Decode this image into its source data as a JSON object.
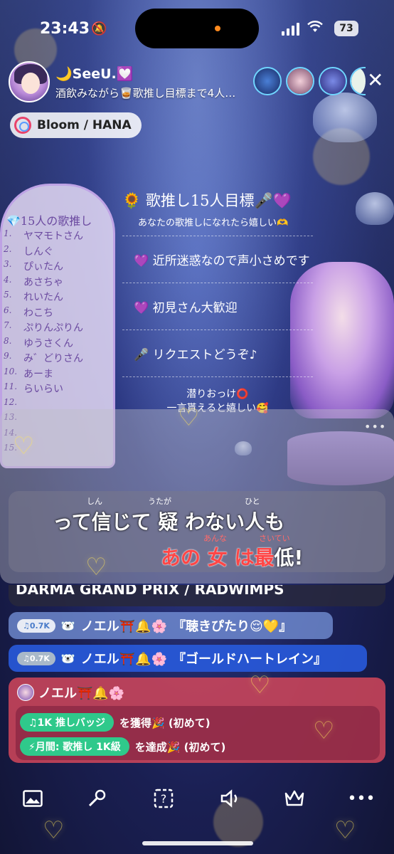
{
  "status": {
    "time": "23:43",
    "battery": "73"
  },
  "header": {
    "streamer_name": "🌙SeeU.💟",
    "subtitle": "酒飲みながら🥃歌推し目標まで4人…",
    "chip_label": "Bloom / HANA"
  },
  "left_panel": {
    "title": "💎15人の歌推し",
    "items": [
      {
        "num": "1.",
        "name": "ヤマモトさん"
      },
      {
        "num": "2.",
        "name": "しんぐ"
      },
      {
        "num": "3.",
        "name": "ぴぃたん"
      },
      {
        "num": "4.",
        "name": "あさちゃ"
      },
      {
        "num": "5.",
        "name": "れいたん"
      },
      {
        "num": "6.",
        "name": "わこち"
      },
      {
        "num": "7.",
        "name": "ぷりんぷりん"
      },
      {
        "num": "8.",
        "name": "ゆうさくん"
      },
      {
        "num": "9.",
        "name": "み゛どりさん"
      },
      {
        "num": "10.",
        "name": "あーま"
      },
      {
        "num": "11.",
        "name": "らいらい"
      },
      {
        "num": "12.",
        "name": ""
      },
      {
        "num": "13.",
        "name": ""
      },
      {
        "num": "14.",
        "name": ""
      },
      {
        "num": "15.",
        "name": ""
      }
    ]
  },
  "rules": {
    "title": "🌻 歌推し15人目標🎤💜",
    "subtitle": "あなたの歌推しになれたら嬉しい🫶",
    "lines": [
      "💜 近所迷惑なので声小さめです",
      "💜 初見さん大歓迎",
      "🎤 リクエストどうぞ♪"
    ],
    "footer_line1": "潜りおっけ⭕️",
    "footer_line2": "一言貰えると嬉しい🥰"
  },
  "lyrics": {
    "line1": "って信じて 疑 わない人も",
    "ruby1": [
      "しん",
      "うたが",
      "ひと"
    ],
    "line2_red": "あの 女 は最",
    "line2_white": "低!",
    "ruby2": [
      "あんな",
      "さいてい"
    ]
  },
  "feed": {
    "now_playing": "DARMA GRAND PRIX / RADWIMPS",
    "requests": [
      {
        "badge": "♫0.7K",
        "user": "ノエル⛩️🔔🌸",
        "song": "『聴きぴたり😌💛』"
      },
      {
        "badge": "♫0.7K",
        "user": "ノエル⛩️🔔🌸",
        "song": "『ゴールドハートレイン』"
      }
    ],
    "gift": {
      "user": "ノエル⛩️🔔🌸",
      "achievements": [
        {
          "pill": "♫1K 推しバッジ",
          "text": "を獲得🎉 (初めて)"
        },
        {
          "pill": "⚡月間: 歌推し 1K級",
          "text": "を達成🎉 (初めて)"
        }
      ]
    }
  },
  "toolbar": {
    "icons": [
      "image-icon",
      "mic-icon",
      "question-icon",
      "speaker-icon",
      "crown-icon",
      "more-icon"
    ]
  }
}
